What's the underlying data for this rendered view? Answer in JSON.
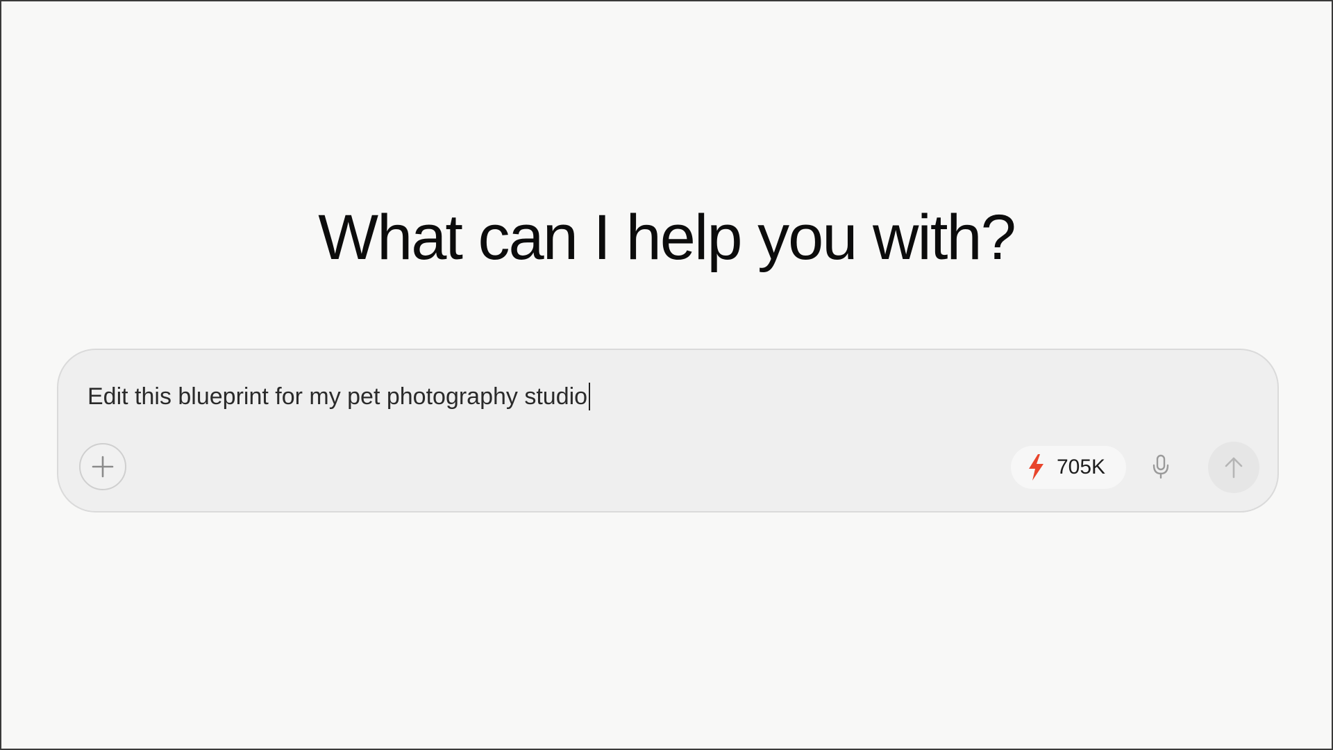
{
  "main": {
    "heading": "What can I help you with?"
  },
  "composer": {
    "input_value": "Edit this blueprint for my pet photography studio",
    "add_icon": "plus-icon",
    "credits": {
      "icon": "lightning-bolt-icon",
      "value": "705K",
      "icon_color": "#e8452c"
    },
    "mic_icon": "microphone-icon",
    "send_icon": "arrow-up-icon"
  }
}
